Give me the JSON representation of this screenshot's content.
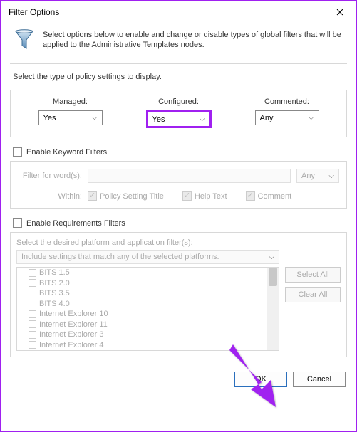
{
  "window": {
    "title": "Filter Options"
  },
  "header": {
    "text": "Select options below to enable and change or disable types of global filters that will be applied to the Administrative Templates nodes."
  },
  "policy": {
    "section_label": "Select the type of policy settings to display.",
    "managed": {
      "label": "Managed:",
      "value": "Yes"
    },
    "configured": {
      "label": "Configured:",
      "value": "Yes"
    },
    "commented": {
      "label": "Commented:",
      "value": "Any"
    }
  },
  "keyword": {
    "enable_label": "Enable Keyword Filters",
    "filter_label": "Filter for word(s):",
    "any_value": "Any",
    "within_label": "Within:",
    "opt_title": "Policy Setting Title",
    "opt_help": "Help Text",
    "opt_comment": "Comment"
  },
  "requirements": {
    "enable_label": "Enable Requirements Filters",
    "desc": "Select the desired platform and application filter(s):",
    "dropdown": "Include settings that match any of the selected platforms.",
    "items": [
      "BITS 1.5",
      "BITS 2.0",
      "BITS 3.5",
      "BITS 4.0",
      "Internet Explorer 10",
      "Internet Explorer 11",
      "Internet Explorer 3",
      "Internet Explorer 4"
    ],
    "select_all": "Select All",
    "clear_all": "Clear All"
  },
  "footer": {
    "ok": "OK",
    "cancel": "Cancel"
  }
}
